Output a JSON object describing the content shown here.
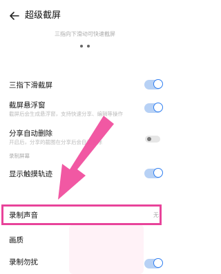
{
  "header": {
    "title": "超级截屏",
    "back_icon": "back-arrow-icon"
  },
  "hint": "三指向下滑动可快速截屏",
  "pager": {
    "total": 2,
    "current": 1
  },
  "settings": {
    "three_finger": {
      "label": "三指下滑截屏",
      "enabled": true
    },
    "floating": {
      "label": "截屏悬浮窗",
      "desc": "截屏后会生成悬浮窗，支持快速分享、编辑等操作",
      "enabled": true
    },
    "auto_delete": {
      "label": "分享自动删除",
      "desc": "开启后，分享的截图在分享后会自动删除",
      "enabled": false
    },
    "section_record": "录制屏幕",
    "touch_track": {
      "label": "显示触摸轨迹",
      "enabled": true
    },
    "record_sound": {
      "label": "录制声音",
      "value": "无"
    },
    "quality": {
      "label": "画质"
    },
    "dnd": {
      "label": "录制勿扰",
      "enabled": true
    }
  },
  "colors": {
    "accent": "#2f7ef0",
    "highlight": "#e8439a",
    "arrow": "#f04f9e"
  }
}
